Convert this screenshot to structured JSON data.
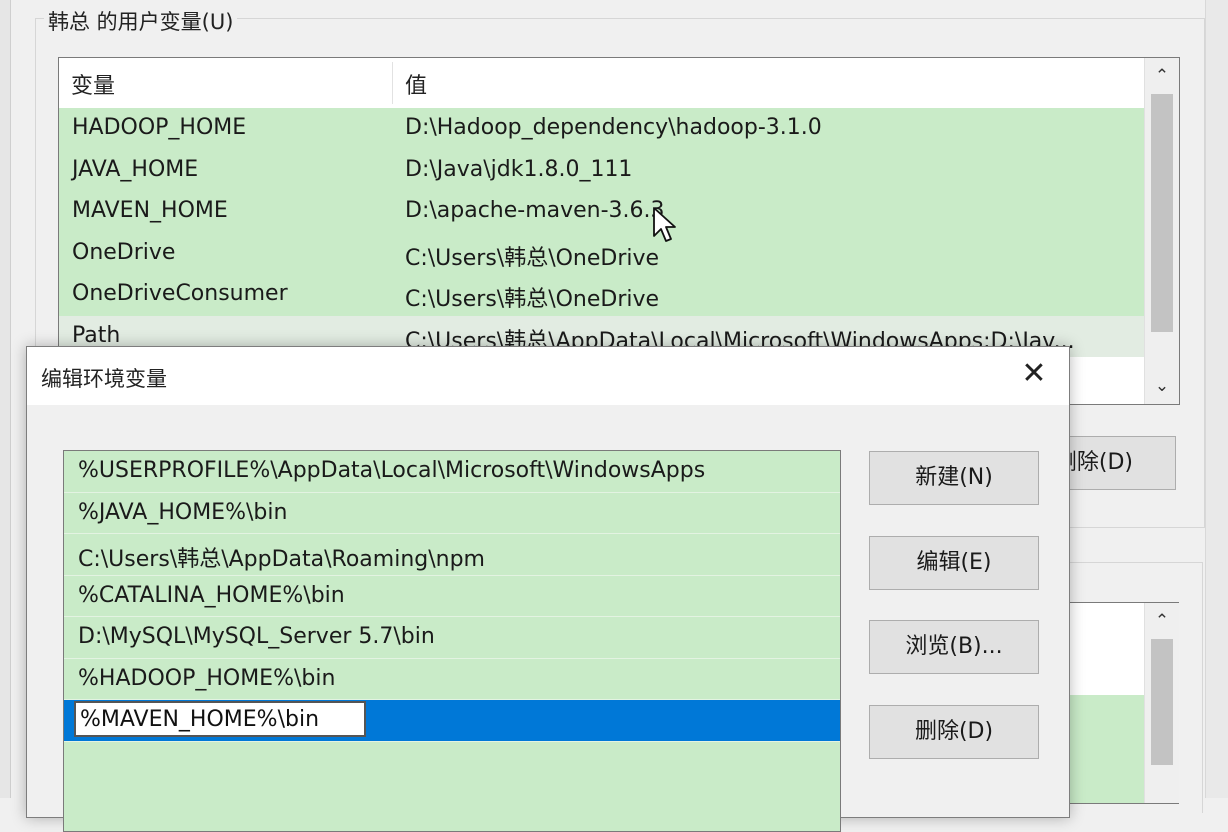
{
  "user_vars": {
    "group_title": "韩总 的用户变量(U)",
    "headers": {
      "name": "变量",
      "value": "值"
    },
    "rows": [
      {
        "name": "HADOOP_HOME",
        "value": "D:\\Hadoop_dependency\\hadoop-3.1.0"
      },
      {
        "name": "JAVA_HOME",
        "value": "D:\\Java\\jdk1.8.0_111"
      },
      {
        "name": "MAVEN_HOME",
        "value": "D:\\apache-maven-3.6.3"
      },
      {
        "name": "OneDrive",
        "value": "C:\\Users\\韩总\\OneDrive"
      },
      {
        "name": "OneDriveConsumer",
        "value": "C:\\Users\\韩总\\OneDrive"
      },
      {
        "name": "Path",
        "value": "C:\\Users\\韩总\\AppData\\Local\\Microsoft\\WindowsApps;D:\\Jav..."
      }
    ],
    "delete_button": "删除(D)"
  },
  "edit_dialog": {
    "title": "编辑环境变量",
    "close_glyph": "✕",
    "entries": [
      "%USERPROFILE%\\AppData\\Local\\Microsoft\\WindowsApps",
      "%JAVA_HOME%\\bin",
      "C:\\Users\\韩总\\AppData\\Roaming\\npm",
      "%CATALINA_HOME%\\bin",
      "D:\\MySQL\\MySQL_Server 5.7\\bin",
      "%HADOOP_HOME%\\bin"
    ],
    "editing_value": "%MAVEN_HOME%\\bin",
    "buttons": {
      "new": "新建(N)",
      "edit": "编辑(E)",
      "browse": "浏览(B)...",
      "delete": "删除(D)"
    }
  },
  "icons": {
    "scroll_up": "⌃",
    "scroll_down": "⌄"
  }
}
